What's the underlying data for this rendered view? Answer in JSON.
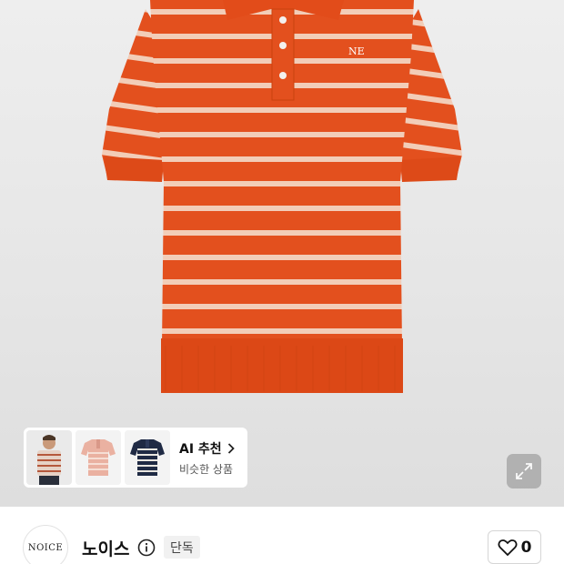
{
  "product": {
    "image": "orange-white-striped-knit-polo-shirt",
    "colors": {
      "body": "#e3501e",
      "stripe": "#f3d8c8",
      "background": "#e8e8e8"
    }
  },
  "ai_recommend": {
    "title": "AI 추천",
    "subtitle": "비슷한 상품",
    "thumbnails": [
      "model-striped-shirt",
      "pink-striped-polo",
      "navy-striped-polo"
    ]
  },
  "brand": {
    "logo_text": "NOICE",
    "name": "노이스",
    "badge": "단독"
  },
  "like": {
    "count": "0"
  },
  "icons": [
    "chevron-right-icon",
    "expand-icon",
    "info-icon",
    "heart-icon"
  ]
}
